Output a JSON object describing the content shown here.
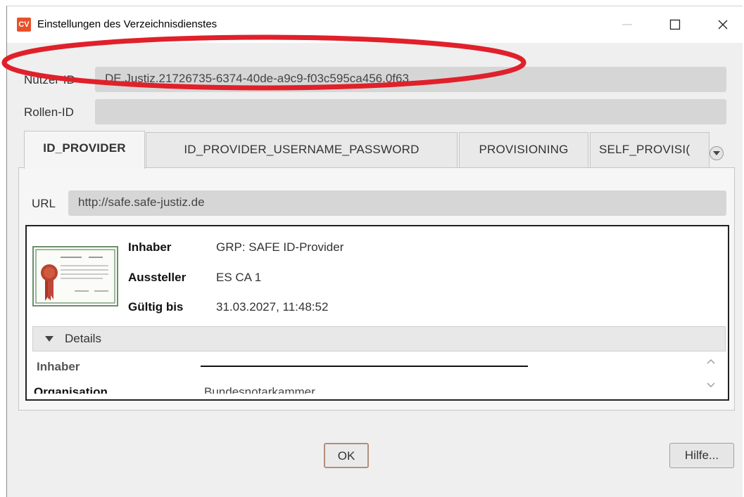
{
  "window": {
    "app_icon_text": "CV",
    "title": "Einstellungen des Verzeichnisdienstes"
  },
  "form": {
    "user_id_label": "Nutzer-ID",
    "user_id_value": "DE.Justiz.21726735-6374-40de-a9c9-f03c595ca456.0f63",
    "role_id_label": "Rollen-ID",
    "role_id_value": ""
  },
  "tabs": [
    {
      "label": "ID_PROVIDER",
      "active": true
    },
    {
      "label": "ID_PROVIDER_USERNAME_PASSWORD",
      "active": false
    },
    {
      "label": "PROVISIONING",
      "active": false
    },
    {
      "label": "SELF_PROVISI(",
      "active": false
    }
  ],
  "url": {
    "label": "URL",
    "value": "http://safe.safe-justiz.de"
  },
  "certificate": {
    "holder_label": "Inhaber",
    "holder_value": "GRP: SAFE ID-Provider",
    "issuer_label": "Aussteller",
    "issuer_value": "ES CA 1",
    "valid_label": "Gültig bis",
    "valid_value": "31.03.2027, 11:48:52"
  },
  "details": {
    "toggle_label": "Details",
    "rows": [
      {
        "label": "Inhaber",
        "value": ""
      },
      {
        "label": "Organisation",
        "value": "Bundesnotarkammer"
      }
    ]
  },
  "buttons": {
    "ok": "OK",
    "help": "Hilfe..."
  },
  "colors": {
    "annotation": "#e0202a",
    "app_icon": "#e8502a"
  },
  "icons": [
    "app-logo-icon",
    "minimize-icon",
    "maximize-icon",
    "close-icon",
    "tab-overflow-icon",
    "certificate-icon",
    "collapse-triangle-icon",
    "scroll-up-icon",
    "scroll-down-icon"
  ]
}
